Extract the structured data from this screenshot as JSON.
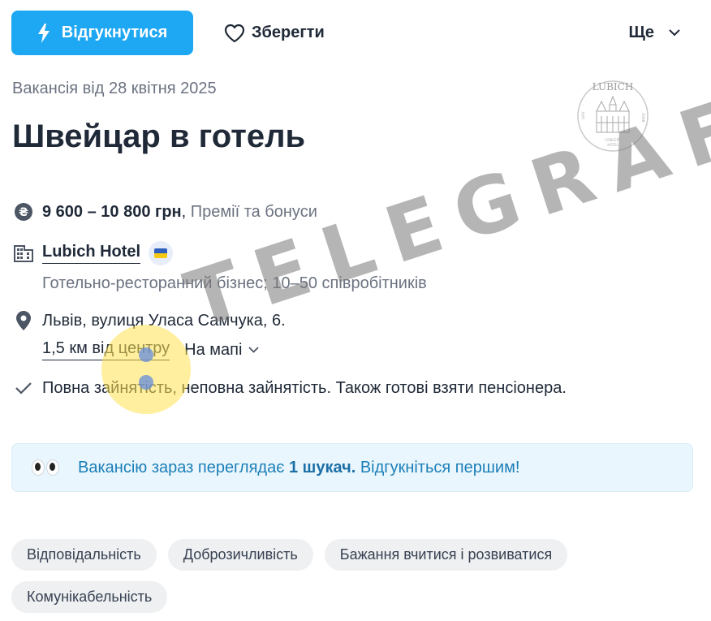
{
  "toolbar": {
    "apply_label": "Відгукнутися",
    "save_label": "Зберегти",
    "more_label": "Ще"
  },
  "vacancy": {
    "date": "Вакансія від 28 квітня 2025",
    "title": "Швейцар в готель",
    "salary": "9 600 – 10 800 грн",
    "salary_sep": ", ",
    "bonus": "Премії та бонуси",
    "company": "Lubich Hotel",
    "industry": "Готельно-ресторанний бізнес; 10–50 співробітників",
    "address": "Львів, вулиця Уласа Самчука, 6.",
    "distance": "1,5 км від центру",
    "map_label": "На мапі",
    "employment": "Повна зайнятість, неповна зайнятість. Також готові взяти пенсіонера."
  },
  "logo": {
    "name": "LUBICH",
    "left_text": "LVIV",
    "right_text": "2008",
    "bottom_line1": "CONCEPT",
    "bottom_line2": "HOTEL"
  },
  "notice": {
    "prefix": "Вакансію зараз переглядає ",
    "count": "1 шукач.",
    "suffix": " Відгукніться першим!"
  },
  "tags": [
    "Відповідальність",
    "Доброзичливість",
    "Бажання вчитися і розвиватися",
    "Комунікабельність"
  ],
  "watermark": "TELEGRAF",
  "colors": {
    "accent": "#1ea7f2",
    "notice_text": "#1b7fb8",
    "flag_blue": "#2f5fbe",
    "flag_yellow": "#f5c814"
  },
  "icons": {
    "apply": "lightning-icon",
    "save": "heart-icon",
    "more": "chevron-down-icon",
    "salary": "hryvnia-icon",
    "company": "building-icon",
    "address": "map-pin-icon",
    "employment": "checkmark-icon"
  }
}
